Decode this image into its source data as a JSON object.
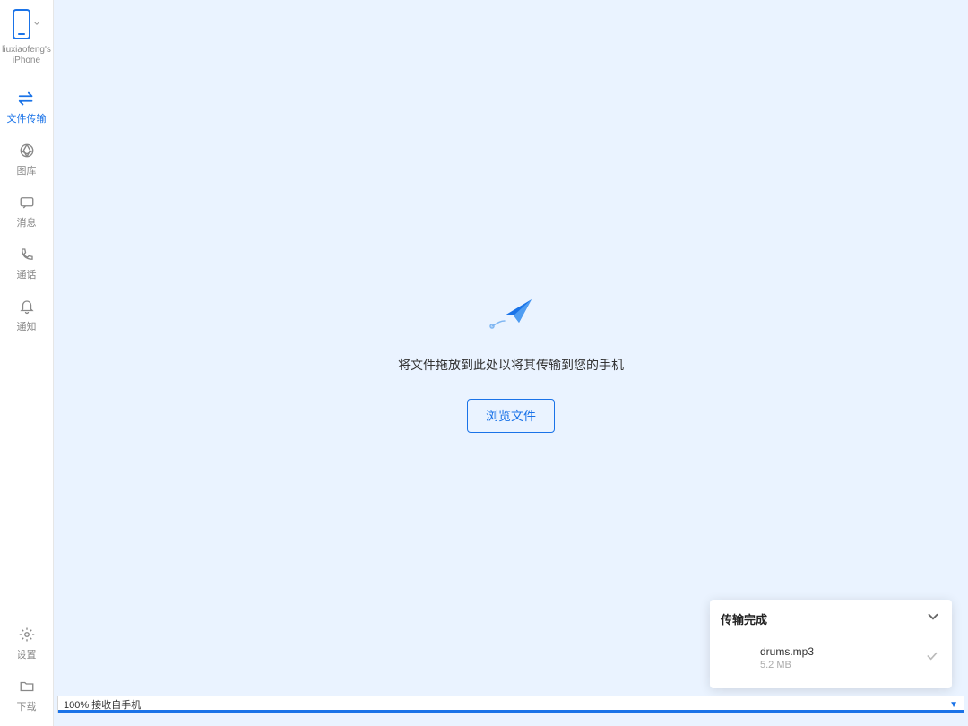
{
  "device": {
    "name": "liuxiaofeng's iPhone"
  },
  "sidebar": {
    "items": [
      {
        "label": "文件传输"
      },
      {
        "label": "图库"
      },
      {
        "label": "消息"
      },
      {
        "label": "通话"
      },
      {
        "label": "通知"
      }
    ],
    "bottom": [
      {
        "label": "设置"
      },
      {
        "label": "下载"
      }
    ]
  },
  "dropzone": {
    "message": "将文件拖放到此处以将其传输到您的手机",
    "browse_label": "浏览文件"
  },
  "transfer_panel": {
    "title": "传输完成",
    "files": [
      {
        "name": "drums.mp3",
        "size": "5.2 MB"
      }
    ]
  },
  "progress": {
    "text": "100% 接收自手机"
  }
}
